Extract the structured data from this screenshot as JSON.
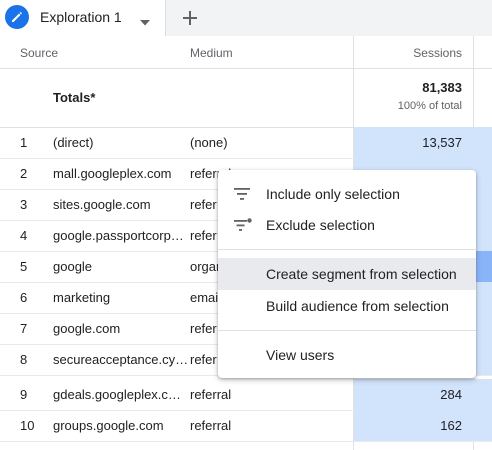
{
  "tab": {
    "title": "Exploration 1"
  },
  "table": {
    "headers": {
      "source": "Source",
      "medium": "Medium",
      "sessions": "Sessions"
    },
    "totals": {
      "label": "Totals*",
      "value": "81,383",
      "sub": "100% of total"
    },
    "rows": [
      {
        "num": "1",
        "source": "(direct)",
        "medium": "(none)",
        "sessions": "13,537"
      },
      {
        "num": "2",
        "source": "mall.googleplex.com",
        "medium": "referral",
        "sessions": ""
      },
      {
        "num": "3",
        "source": "sites.google.com",
        "medium": "refer",
        "sessions": ""
      },
      {
        "num": "4",
        "source": "google.passportcorp…",
        "medium": "refer",
        "sessions": ""
      },
      {
        "num": "5",
        "source": "google",
        "medium": "organ",
        "sessions": ""
      },
      {
        "num": "6",
        "source": "marketing",
        "medium": "emai",
        "sessions": ""
      },
      {
        "num": "7",
        "source": "google.com",
        "medium": "refer",
        "sessions": ""
      },
      {
        "num": "8",
        "source": "secureacceptance.cy…",
        "medium": "refer",
        "sessions": ""
      },
      {
        "num": "9",
        "source": "gdeals.googleplex.c…",
        "medium": "referral",
        "sessions": "284"
      },
      {
        "num": "10",
        "source": "groups.google.com",
        "medium": "referral",
        "sessions": "162"
      }
    ]
  },
  "menu": {
    "items": [
      {
        "label": "Include only selection",
        "icon": "filter-icon"
      },
      {
        "label": "Exclude selection",
        "icon": "filter-exclude-icon"
      },
      {
        "label": "Create segment from selection",
        "icon": ""
      },
      {
        "label": "Build audience from selection",
        "icon": ""
      },
      {
        "label": "View users",
        "icon": ""
      }
    ]
  },
  "colors": {
    "accent": "#1a73e8",
    "sessions_fill": "#d2e3fc",
    "row_highlight": "#8ab4f8"
  }
}
